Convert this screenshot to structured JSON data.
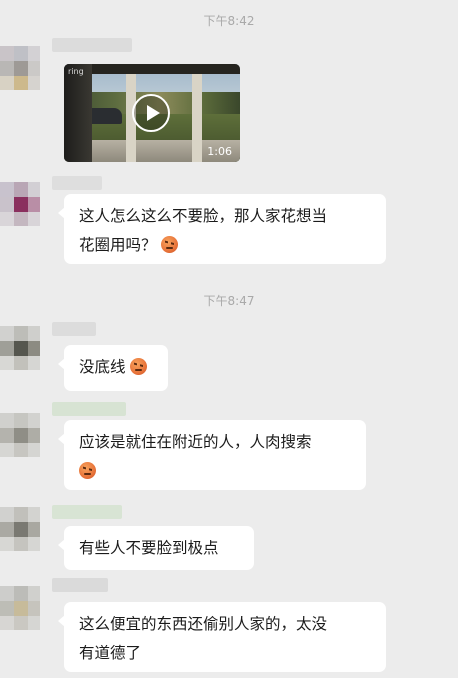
{
  "timestamps": [
    "下午8:42",
    "下午8:47"
  ],
  "video_message": {
    "duration": "1:06",
    "watermark": "ring"
  },
  "messages": [
    {
      "line1": "这人怎么这么不要脸，那人家花想当",
      "line2": "花圈用吗？",
      "emoji": "angry-face-emoji"
    },
    {
      "line1": "没底线",
      "emoji": "angry-face-emoji"
    },
    {
      "line1": "应该是就住在附近的人，人肉搜索",
      "emoji": "angry-face-emoji"
    },
    {
      "line1": "有些人不要脸到极点"
    },
    {
      "line1": "这么便宜的东西还偷别人家的，太没",
      "line2": "有道德了"
    }
  ],
  "colors": {
    "background": "#ececec",
    "bubble": "#ffffff",
    "timestamp": "#a9a9a9",
    "text": "#1b1b1b"
  }
}
